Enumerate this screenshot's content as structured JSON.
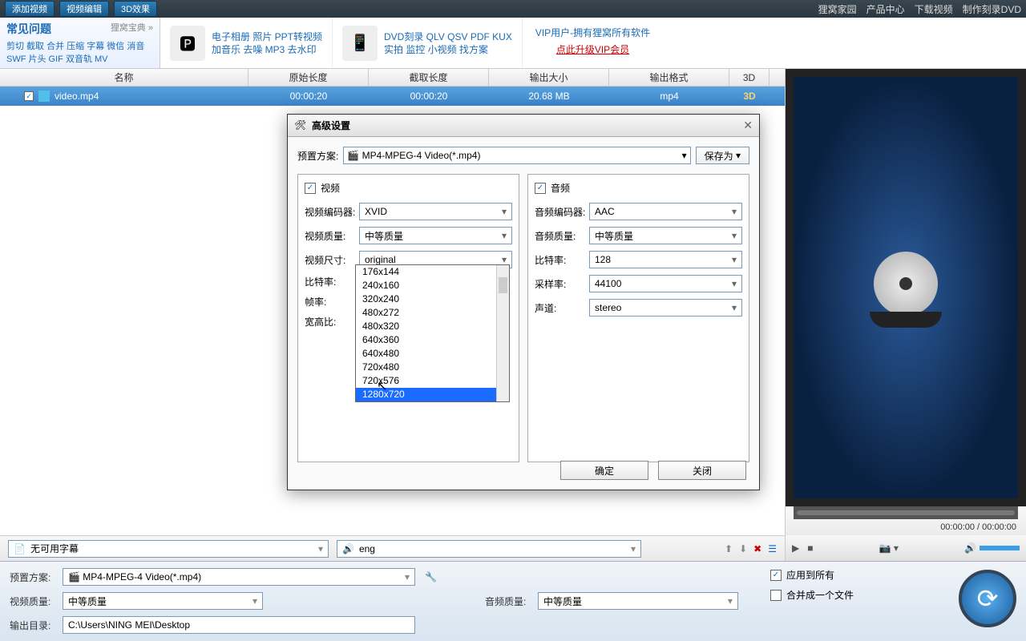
{
  "topbar": {
    "addVideo": "添加视频",
    "editVideo": "视频编辑",
    "fx3d": "3D效果",
    "home": "狸窝家园",
    "prod": "产品中心",
    "dl": "下载视频",
    "dvd": "制作刻录DVD"
  },
  "faq": {
    "title": "常见问题",
    "sub": "狸窝宝典 »",
    "tags": "剪切 截取 合并 压缩 字幕 微信 消音 SWF 片头 GIF 双音轨 MV"
  },
  "promoA": {
    "line": "电子相册 照片 PPT转视频\n加音乐 去噪 MP3 去水印"
  },
  "promoB": {
    "line": "DVD刻录 QLV QSV PDF KUX\n实拍 监控 小视频 找方案"
  },
  "vip": {
    "line": "VIP用户-拥有狸窝所有软件",
    "upg": "点此升级VIP会员"
  },
  "cols": {
    "name": "名称",
    "orig": "原始长度",
    "cut": "截取长度",
    "size": "输出大小",
    "fmt": "输出格式",
    "td": "3D"
  },
  "file": {
    "name": "video.mp4",
    "orig": "00:00:20",
    "cut": "00:00:20",
    "size": "20.68 MB",
    "fmt": "mp4",
    "td": "3D"
  },
  "dialog": {
    "title": "高级设置",
    "presetLbl": "预置方案:",
    "preset": "MP4-MPEG-4 Video(*.mp4)",
    "saveAs": "保存为",
    "video": "视频",
    "audio": "音频",
    "vCodecLbl": "视频编码器:",
    "vCodec": "XVID",
    "vQualLbl": "视频质量:",
    "vQual": "中等质量",
    "vSizeLbl": "视频尺寸:",
    "vSize": "original",
    "vBitLbl": "比特率:",
    "vFpsLbl": "帧率:",
    "vAspLbl": "宽高比:",
    "aCodecLbl": "音频编码器:",
    "aCodec": "AAC",
    "aQualLbl": "音频质量:",
    "aQual": "中等质量",
    "aBitLbl": "比特率:",
    "aBit": "128",
    "aRateLbl": "采样率:",
    "aRate": "44100",
    "aChLbl": "声道:",
    "aCh": "stereo",
    "ok": "确定",
    "close": "关闭"
  },
  "sizeOpts": [
    "176x144",
    "240x160",
    "320x240",
    "480x272",
    "480x320",
    "640x360",
    "640x480",
    "720x480",
    "720x576",
    "1280x720"
  ],
  "sizeSelected": "1280x720",
  "subbar": {
    "noSub": "无可用字幕",
    "lang": "eng"
  },
  "bottom": {
    "presetLbl": "预置方案:",
    "preset": "MP4-MPEG-4 Video(*.mp4)",
    "vQualLbl": "视频质量:",
    "vQual": "中等质量",
    "aQualLbl": "音频质量:",
    "aQual": "中等质量",
    "outLbl": "输出目录:",
    "out": "C:\\Users\\NING MEI\\Desktop",
    "applyAll": "应用到所有",
    "merge": "合并成一个文件"
  },
  "time": "00:00:00 / 00:00:00"
}
